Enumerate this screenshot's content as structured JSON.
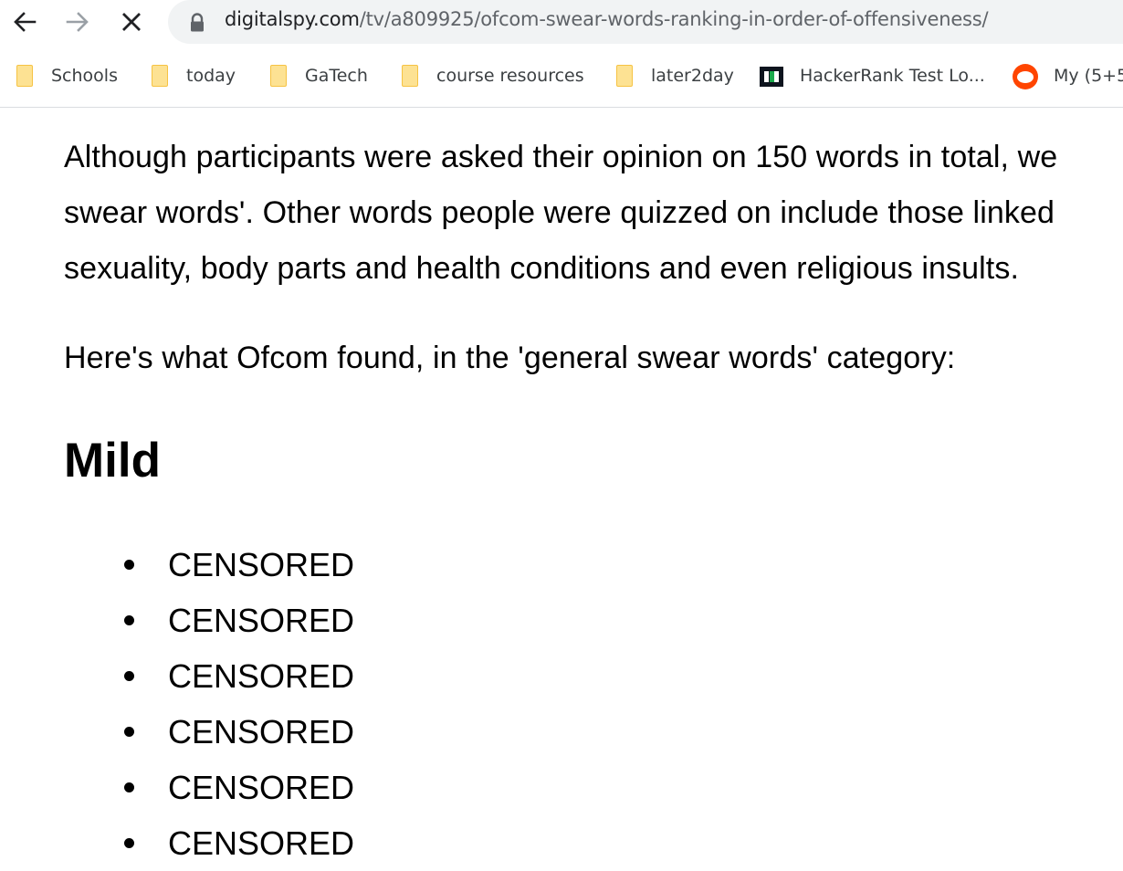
{
  "browser": {
    "url_host": "digitalspy.com",
    "url_path": "/tv/a809925/ofcom-swear-words-ranking-in-order-of-offensiveness/",
    "icons": {
      "back": "back-arrow-icon",
      "forward": "forward-arrow-icon",
      "stop": "close-icon",
      "lock": "lock-icon"
    },
    "bookmarks": [
      {
        "label": "Schools",
        "icon": "folder-icon"
      },
      {
        "label": "today",
        "icon": "folder-icon"
      },
      {
        "label": "GaTech",
        "icon": "folder-icon"
      },
      {
        "label": "course resources",
        "icon": "folder-icon"
      },
      {
        "label": "later2day",
        "icon": "folder-icon"
      },
      {
        "label": "HackerRank Test Lo...",
        "icon": "hackerrank-icon"
      },
      {
        "label": "My (5+5",
        "icon": "reddit-icon"
      }
    ]
  },
  "article": {
    "para1_line1": "Although participants were asked their opinion on 150 words in total, we",
    "para1_line2": "swear words'. Other words people were quizzed on include those linked",
    "para1_line3": "sexuality, body parts and health conditions and even religious insults.",
    "para2": "Here's what Ofcom found, in the 'general swear words' category:",
    "heading": "Mild",
    "items": [
      "CENSORED",
      "CENSORED",
      "CENSORED",
      "CENSORED",
      "CENSORED",
      "CENSORED"
    ]
  }
}
